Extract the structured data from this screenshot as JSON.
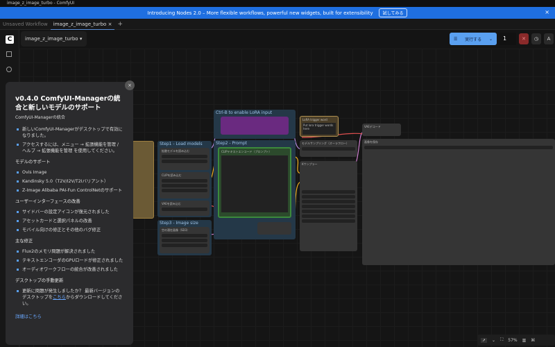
{
  "window": {
    "title": "image_z_image_turbo - ComfyUI"
  },
  "banner": {
    "text": "Introducing Nodes 2.0 – More flexible workflows, powerful new widgets, built for extensibility",
    "button": "試してみる",
    "close": "×"
  },
  "tabs": [
    {
      "label": "Unsaved Workflow"
    },
    {
      "label": "image_z_image_turbo",
      "close": "×"
    }
  ],
  "tabs_add": "+",
  "workflow": {
    "name": "image_z_image_turbo",
    "chevron": "▾"
  },
  "run": {
    "label": "実行する",
    "count": "1"
  },
  "graph": {
    "groups": [
      "Step1 - Load models",
      "Step3 - Image size",
      "Ctrl-B to enable LoRA input",
      "Step2 - Prompt"
    ],
    "nodes": [
      "LoRA trigger word",
      "VAEデコード",
      "画像を保存",
      "CLIPテキストエンコード（プロンプト）",
      "Kサンプラー",
      "モデルサンプリング（オーラフロー）",
      "拡散モデルを読み込む",
      "CLIPを読み込む",
      "VAEを読み込む",
      "空の潜在画像（SD3）"
    ],
    "lora_text": "Put lora trigger words here"
  },
  "popup": {
    "title": "v0.4.0 ComfyUI-Managerの統合と新しいモデルのサポート",
    "subtitle": "ComfyUI-Managerの統合",
    "intro": [
      "新しいComfyUI-Managerがデスクトップで有効になりました。",
      "アクセスするには、メニュー → 拡張機能を管理 / ヘルプ → 拡張機能を管理 を使用してください。"
    ],
    "models_heading": "モデルのサポート",
    "models": [
      "Ovis Image",
      "Kandinsky 5.0（T2V/I2V/T2Iバリアント）",
      "Z-Image Alibaba PAI-Fun ControlNetのサポート"
    ],
    "ui_heading": "ユーザーインターフェースの改善",
    "ui": [
      "サイドバーの設定アイコンが復元されました",
      "アセットカードと選択パネルの改善",
      "モバイル向けの修正とその他のバグ修正"
    ],
    "fixes_heading": "主な修正",
    "fixes": [
      "Flux2のメモリ問題が解決されました",
      "テキストエンコーダのGPUロードが修正されました",
      "オーディオワークフローの統合が改善されました"
    ],
    "desktop_heading": "デスクトップの手動更新",
    "desktop_pre": "更新に問題が発生しましたか？ 最新バージョンのデスクトップを",
    "desktop_link": "こちら",
    "desktop_post": "からダウンロードしてください。",
    "more_link": "詳細はこちら",
    "close": "×"
  },
  "bottom": {
    "zoom": "57%"
  }
}
